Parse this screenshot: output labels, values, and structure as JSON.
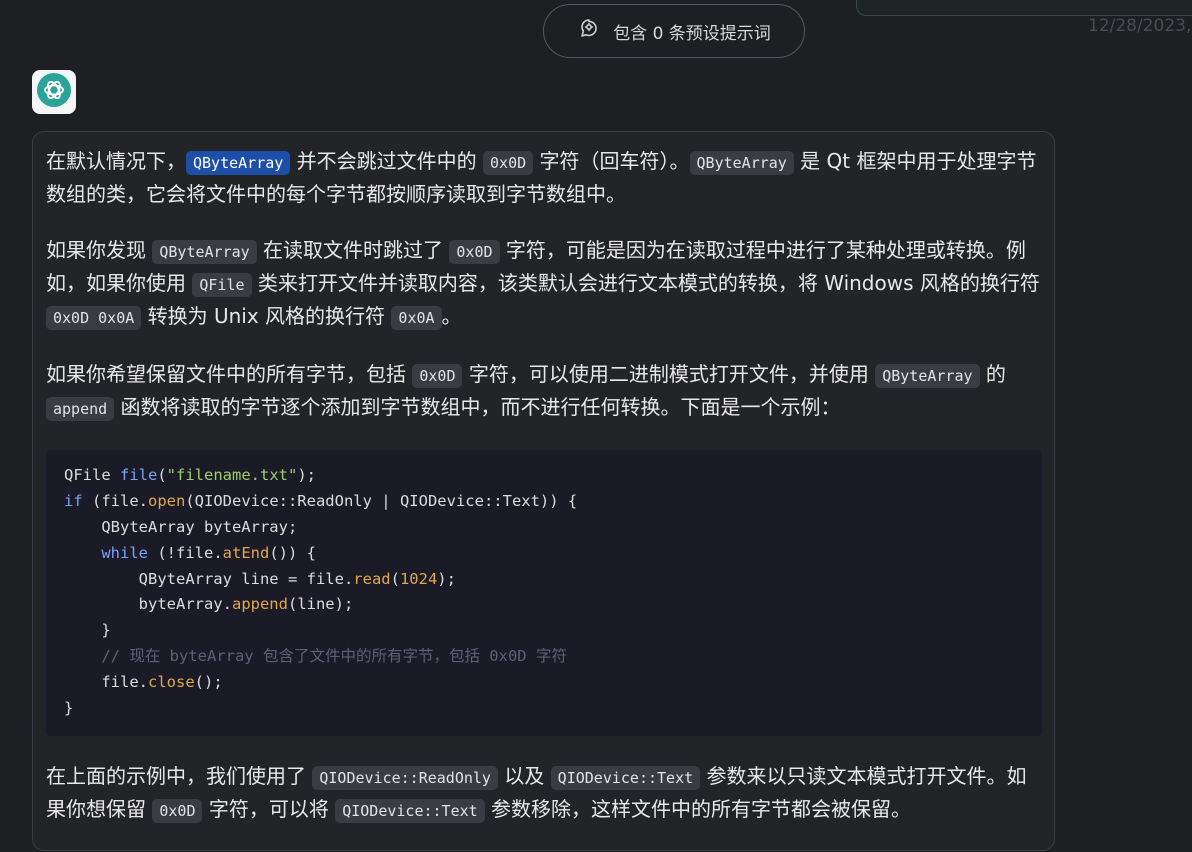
{
  "header": {
    "prompt_pill_label": "包含 0 条预设提示词",
    "date": "12/28/2023,"
  },
  "message": {
    "paragraphs": [
      {
        "segments": [
          {
            "t": "在默认情况下，"
          },
          {
            "c": "QByteArray",
            "sel": true
          },
          {
            "t": " 并不会跳过文件中的 "
          },
          {
            "c": "0x0D"
          },
          {
            "t": " 字符（回车符）。"
          },
          {
            "c": "QByteArray"
          },
          {
            "t": " 是 Qt 框架中用于处理字节数组的类，它会将文件中的每个字节都按顺序读取到字节数组中。"
          }
        ]
      },
      {
        "segments": [
          {
            "t": "如果你发现 "
          },
          {
            "c": "QByteArray"
          },
          {
            "t": " 在读取文件时跳过了 "
          },
          {
            "c": "0x0D"
          },
          {
            "t": " 字符，可能是因为在读取过程中进行了某种处理或转换。例如，如果你使用 "
          },
          {
            "c": "QFile"
          },
          {
            "t": " 类来打开文件并读取内容，该类默认会进行文本模式的转换，将 Windows 风格的换行符 "
          },
          {
            "c": "0x0D 0x0A"
          },
          {
            "t": " 转换为 Unix 风格的换行符 "
          },
          {
            "c": "0x0A"
          },
          {
            "t": "。"
          }
        ]
      },
      {
        "segments": [
          {
            "t": "如果你希望保留文件中的所有字节，包括 "
          },
          {
            "c": "0x0D"
          },
          {
            "t": " 字符，可以使用二进制模式打开文件，并使用 "
          },
          {
            "c": "QByteArray"
          },
          {
            "t": " 的 "
          },
          {
            "c": "append"
          },
          {
            "t": " 函数将读取的字节逐个添加到字节数组中，而不进行任何转换。下面是一个示例："
          }
        ]
      }
    ],
    "code_lines": [
      [
        {
          "t": "QFile "
        },
        {
          "t": "file",
          "k": "kw"
        },
        {
          "t": "("
        },
        {
          "t": "\"filename.txt\"",
          "k": "str"
        },
        {
          "t": ");"
        }
      ],
      [
        {
          "t": "if",
          "k": "kw"
        },
        {
          "t": " (file."
        },
        {
          "t": "open",
          "k": "fn"
        },
        {
          "t": "(QIODevice::ReadOnly | QIODevice::Text)) {"
        }
      ],
      [
        {
          "t": "    QByteArray byteArray;"
        }
      ],
      [
        {
          "t": "    "
        },
        {
          "t": "while",
          "k": "kw"
        },
        {
          "t": " (!file."
        },
        {
          "t": "atEnd",
          "k": "fn"
        },
        {
          "t": "()) {"
        }
      ],
      [
        {
          "t": "        QByteArray line = file."
        },
        {
          "t": "read",
          "k": "fn"
        },
        {
          "t": "("
        },
        {
          "t": "1024",
          "k": "num"
        },
        {
          "t": ");"
        }
      ],
      [
        {
          "t": "        byteArray."
        },
        {
          "t": "append",
          "k": "fn"
        },
        {
          "t": "(line);"
        }
      ],
      [
        {
          "t": "    }"
        }
      ],
      [
        {
          "t": "    // 现在 byteArray 包含了文件中的所有字节，包括 0x0D 字符",
          "k": "cm"
        }
      ],
      [
        {
          "t": "    file."
        },
        {
          "t": "close",
          "k": "fn"
        },
        {
          "t": "();"
        }
      ],
      [
        {
          "t": "}"
        }
      ]
    ],
    "after_paragraphs": [
      {
        "segments": [
          {
            "t": "在上面的示例中，我们使用了 "
          },
          {
            "c": "QIODevice::ReadOnly"
          },
          {
            "t": " 以及 "
          },
          {
            "c": "QIODevice::Text"
          },
          {
            "t": " 参数来以只读文本模式打开文件。如果你想保留 "
          },
          {
            "c": "0x0D"
          },
          {
            "t": " 字符，可以将 "
          },
          {
            "c": "QIODevice::Text"
          },
          {
            "t": " 参数移除，这样文件中的所有字节都会被保留。"
          }
        ]
      }
    ]
  }
}
